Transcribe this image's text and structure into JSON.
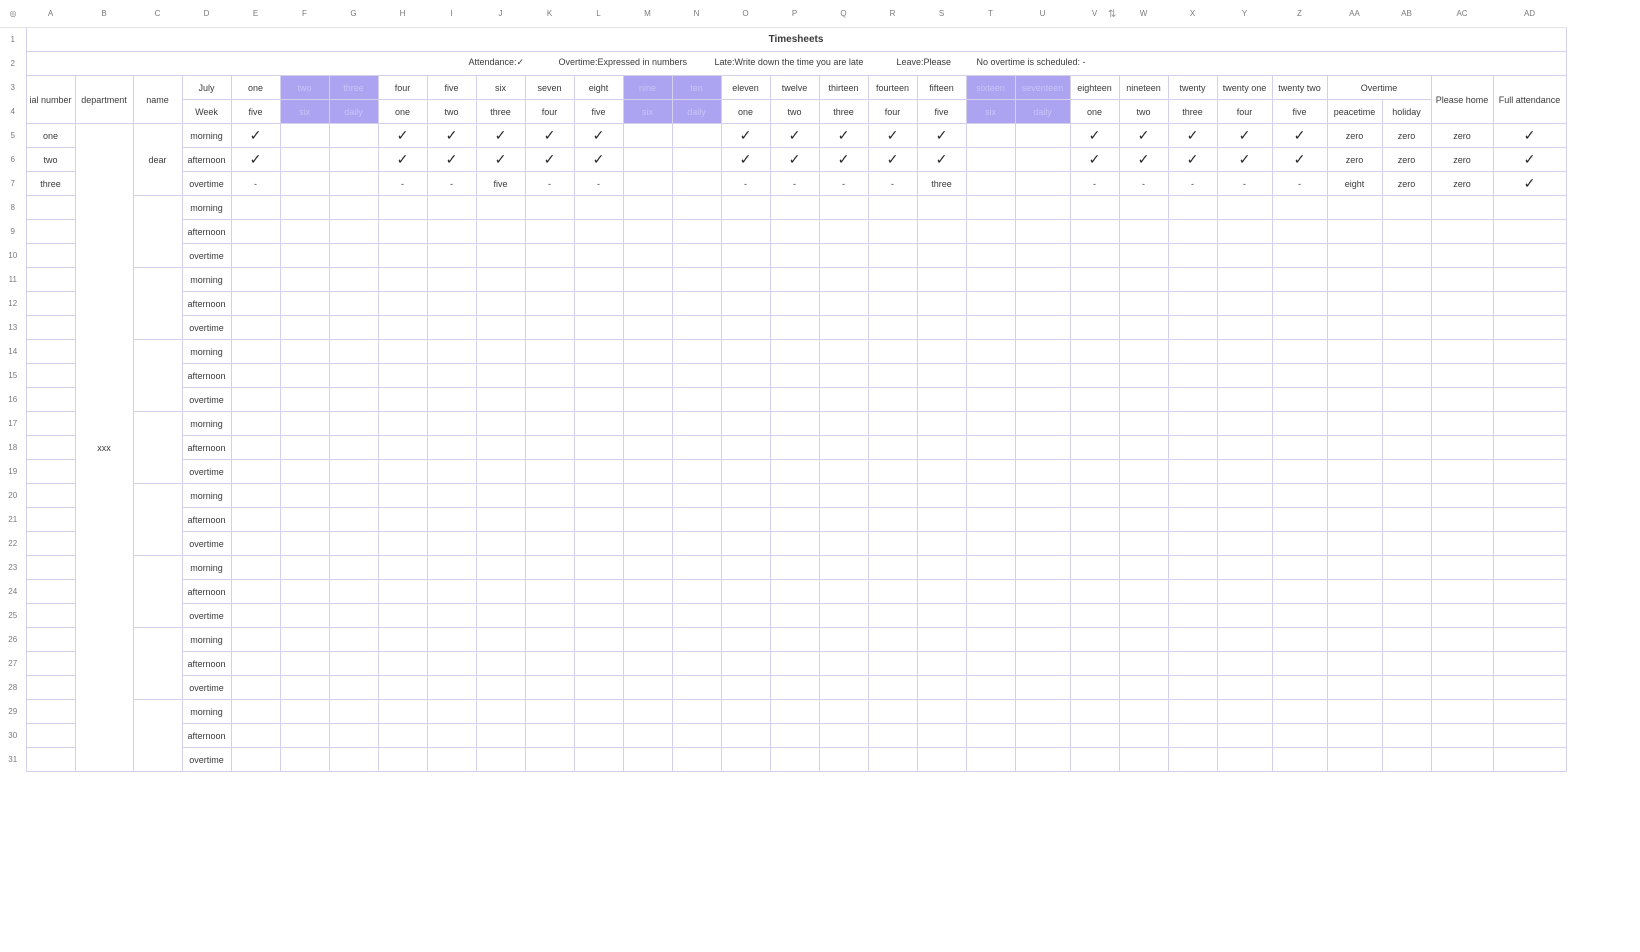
{
  "sheet": {
    "corner_icon": "select-all-icon",
    "corner_glyph": "◎",
    "cols": [
      "A",
      "B",
      "C",
      "D",
      "E",
      "F",
      "G",
      "H",
      "I",
      "J",
      "K",
      "L",
      "M",
      "N",
      "O",
      "P",
      "Q",
      "R",
      "S",
      "T",
      "U",
      "V",
      "W",
      "X",
      "Y",
      "Z",
      "AA",
      "AB",
      "AC",
      "AD"
    ],
    "title": "Timesheets",
    "legend": {
      "attendance": "Attendance:✓",
      "overtime": "Overtime:Expressed in numbers",
      "late": "Late:Write down the time you are late",
      "leave": "Leave:Please",
      "no_overtime": "No overtime is scheduled: -"
    },
    "header": {
      "serial_number": "ial number",
      "department": "department",
      "name": "name",
      "july": "July",
      "week": "Week",
      "days": [
        "one",
        "two",
        "three",
        "four",
        "five",
        "six",
        "seven",
        "eight",
        "nine",
        "ten",
        "eleven",
        "twelve",
        "thirteen",
        "fourteen",
        "fifteen",
        "sixteen",
        "seventeen",
        "eighteen",
        "nineteen",
        "twenty",
        "twenty one",
        "twenty two"
      ],
      "weekdays": [
        "five",
        "six",
        "daily",
        "one",
        "two",
        "three",
        "four",
        "five",
        "six",
        "daily",
        "one",
        "two",
        "three",
        "four",
        "five",
        "six",
        "daily",
        "one",
        "two",
        "three",
        "four",
        "five"
      ],
      "overtime": "Overtime",
      "peacetime": "peacetime",
      "holiday": "holiday",
      "please_home": "Please home",
      "full_attendance": "Full attendance"
    },
    "department_value": "xxx",
    "name_value": "dear",
    "weekend_cols": [
      1,
      2,
      8,
      9,
      15,
      16
    ],
    "rows": [
      {
        "num": "one",
        "shift": "morning",
        "cells": [
          "✓",
          "",
          "",
          "✓",
          "✓",
          "✓",
          "✓",
          "✓",
          "",
          "",
          "✓",
          "✓",
          "✓",
          "✓",
          "✓",
          "",
          "",
          "✓",
          "✓",
          "✓",
          "✓",
          "✓"
        ],
        "peacetime": "zero",
        "holiday": "zero",
        "please_home": "zero",
        "full": "✓"
      },
      {
        "num": "two",
        "shift": "afternoon",
        "cells": [
          "✓",
          "",
          "",
          "✓",
          "✓",
          "✓",
          "✓",
          "✓",
          "",
          "",
          "✓",
          "✓",
          "✓",
          "✓",
          "✓",
          "",
          "",
          "✓",
          "✓",
          "✓",
          "✓",
          "✓"
        ],
        "peacetime": "zero",
        "holiday": "zero",
        "please_home": "zero",
        "full": "✓"
      },
      {
        "num": "three",
        "shift": "overtime",
        "cells": [
          "-",
          "",
          "",
          "-",
          "-",
          "five",
          "-",
          "-",
          "",
          "",
          "-",
          "-",
          "-",
          "-",
          "three",
          "",
          "",
          "-",
          "-",
          "-",
          "-",
          "-"
        ],
        "peacetime": "eight",
        "holiday": "zero",
        "please_home": "zero",
        "full": "✓"
      }
    ],
    "empty_shifts": [
      "morning",
      "afternoon",
      "overtime"
    ],
    "empty_groups": 8,
    "row_numbers": [
      "1",
      "2",
      "3",
      "4",
      "5",
      "6",
      "7",
      "8",
      "9",
      "10",
      "11",
      "12",
      "13",
      "14",
      "15",
      "16",
      "17",
      "18",
      "19",
      "20",
      "21",
      "22",
      "23",
      "24",
      "25",
      "26",
      "27",
      "28",
      "29",
      "30",
      "31"
    ],
    "col_resize_icon": "column-resize-icon"
  }
}
